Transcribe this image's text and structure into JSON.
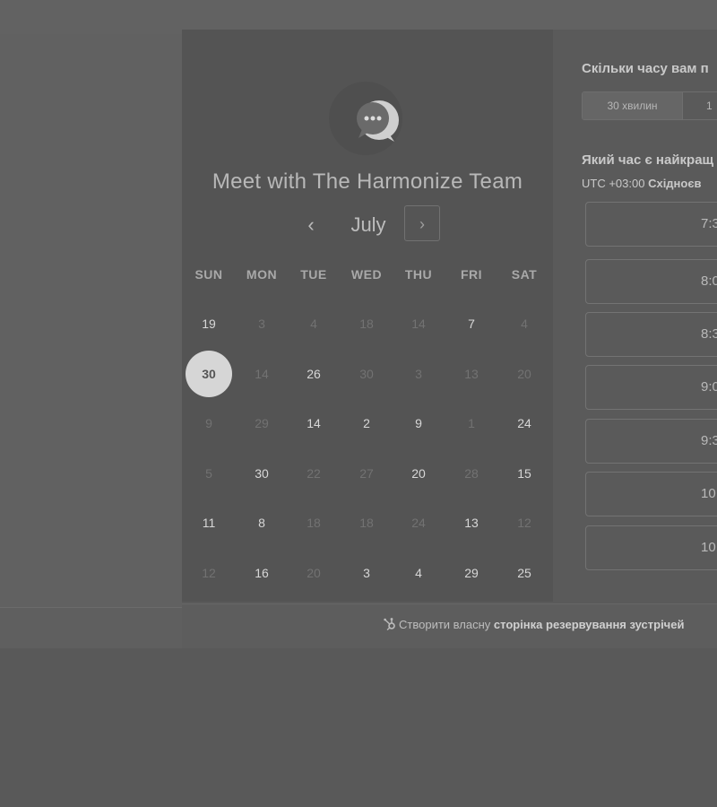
{
  "calendar": {
    "title": "Meet with The Harmonize Team",
    "month": "July",
    "prev_glyph": "‹",
    "next_glyph": "›",
    "weekdays": [
      "SUN",
      "MON",
      "TUE",
      "WED",
      "THU",
      "FRI",
      "SAT"
    ],
    "weeks": [
      [
        {
          "d": "19",
          "active": true
        },
        {
          "d": "3",
          "active": false
        },
        {
          "d": "4",
          "active": false
        },
        {
          "d": "18",
          "active": false
        },
        {
          "d": "14",
          "active": false
        },
        {
          "d": "7",
          "active": true
        },
        {
          "d": "4",
          "active": false
        }
      ],
      [
        {
          "d": "30",
          "active": true,
          "selected": true
        },
        {
          "d": "14",
          "active": false
        },
        {
          "d": "26",
          "active": true
        },
        {
          "d": "30",
          "active": false
        },
        {
          "d": "3",
          "active": false
        },
        {
          "d": "13",
          "active": false
        },
        {
          "d": "20",
          "active": false
        }
      ],
      [
        {
          "d": "9",
          "active": false
        },
        {
          "d": "29",
          "active": false
        },
        {
          "d": "14",
          "active": true
        },
        {
          "d": "2",
          "active": true
        },
        {
          "d": "9",
          "active": true
        },
        {
          "d": "1",
          "active": false
        },
        {
          "d": "24",
          "active": true
        }
      ],
      [
        {
          "d": "5",
          "active": false
        },
        {
          "d": "30",
          "active": true
        },
        {
          "d": "22",
          "active": false
        },
        {
          "d": "27",
          "active": false
        },
        {
          "d": "20",
          "active": true
        },
        {
          "d": "28",
          "active": false
        },
        {
          "d": "15",
          "active": true
        }
      ],
      [
        {
          "d": "11",
          "active": true
        },
        {
          "d": "8",
          "active": true
        },
        {
          "d": "18",
          "active": false
        },
        {
          "d": "18",
          "active": false
        },
        {
          "d": "24",
          "active": false
        },
        {
          "d": "13",
          "active": true
        },
        {
          "d": "12",
          "active": false
        }
      ],
      [
        {
          "d": "12",
          "active": false
        },
        {
          "d": "16",
          "active": true
        },
        {
          "d": "20",
          "active": false
        },
        {
          "d": "3",
          "active": true
        },
        {
          "d": "4",
          "active": true
        },
        {
          "d": "29",
          "active": true
        },
        {
          "d": "25",
          "active": true
        }
      ]
    ]
  },
  "booking": {
    "duration_heading": "Скільки часу вам п",
    "durations": [
      "30 хвилин",
      "1"
    ],
    "time_heading": "Який час є найкращ",
    "timezone_offset": "UTC +03:00",
    "timezone_name": "Східноєв",
    "slots": [
      "7:3",
      "8:0",
      "8:3",
      "9:0",
      "9:3",
      "10:",
      "10:"
    ]
  },
  "footer": {
    "prefix": "Створити власну",
    "bold": "сторінка резервування зустрічей"
  },
  "colors": {
    "overlay_gray": "#545454",
    "selected_day": "#d6d6d6"
  },
  "icons": {
    "avatar": "chat-bubble-logo-icon",
    "footer": "hubspot-sprocket-icon"
  }
}
